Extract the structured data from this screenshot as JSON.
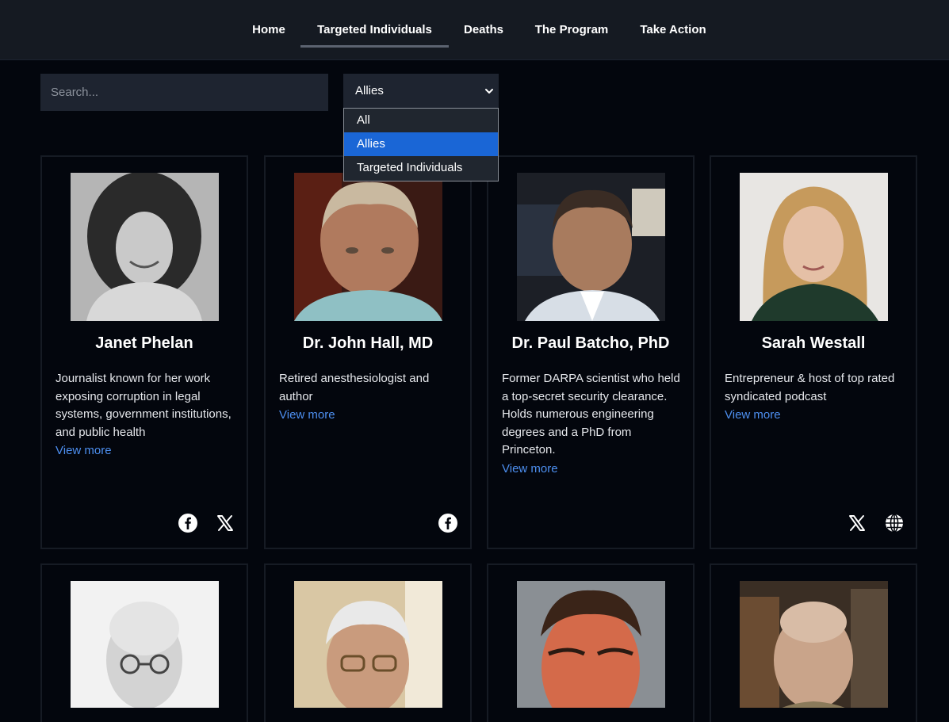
{
  "nav": {
    "items": [
      {
        "label": "Home"
      },
      {
        "label": "Targeted Individuals"
      },
      {
        "label": "Deaths"
      },
      {
        "label": "The Program"
      },
      {
        "label": "Take Action"
      }
    ],
    "active": "Targeted Individuals"
  },
  "filters": {
    "search_placeholder": "Search...",
    "select_value": "Allies",
    "options": [
      "All",
      "Allies",
      "Targeted Individuals"
    ]
  },
  "people": [
    {
      "name": "Janet Phelan",
      "description": "Journalist known for her work exposing corruption in legal systems, government institutions, and public health",
      "view_more": "View more",
      "socials": [
        "facebook-icon",
        "x-icon"
      ]
    },
    {
      "name": "Dr. John Hall, MD",
      "description": "Retired anesthesiologist and author",
      "view_more": "View more",
      "socials": [
        "facebook-icon"
      ]
    },
    {
      "name": "Dr. Paul Batcho, PhD",
      "description": "Former DARPA scientist who held a top-secret security clearance. Holds numerous engineering degrees and a PhD from Princeton.",
      "view_more": "View more",
      "socials": []
    },
    {
      "name": "Sarah Westall",
      "description": "Entrepreneur & host of top rated syndicated podcast",
      "view_more": "View more",
      "socials": [
        "x-icon",
        "globe-icon"
      ]
    }
  ],
  "colors": {
    "background": "#03060d",
    "nav_background": "#151a22",
    "link": "#4d8ff0",
    "selected_option": "#1a66d6"
  }
}
